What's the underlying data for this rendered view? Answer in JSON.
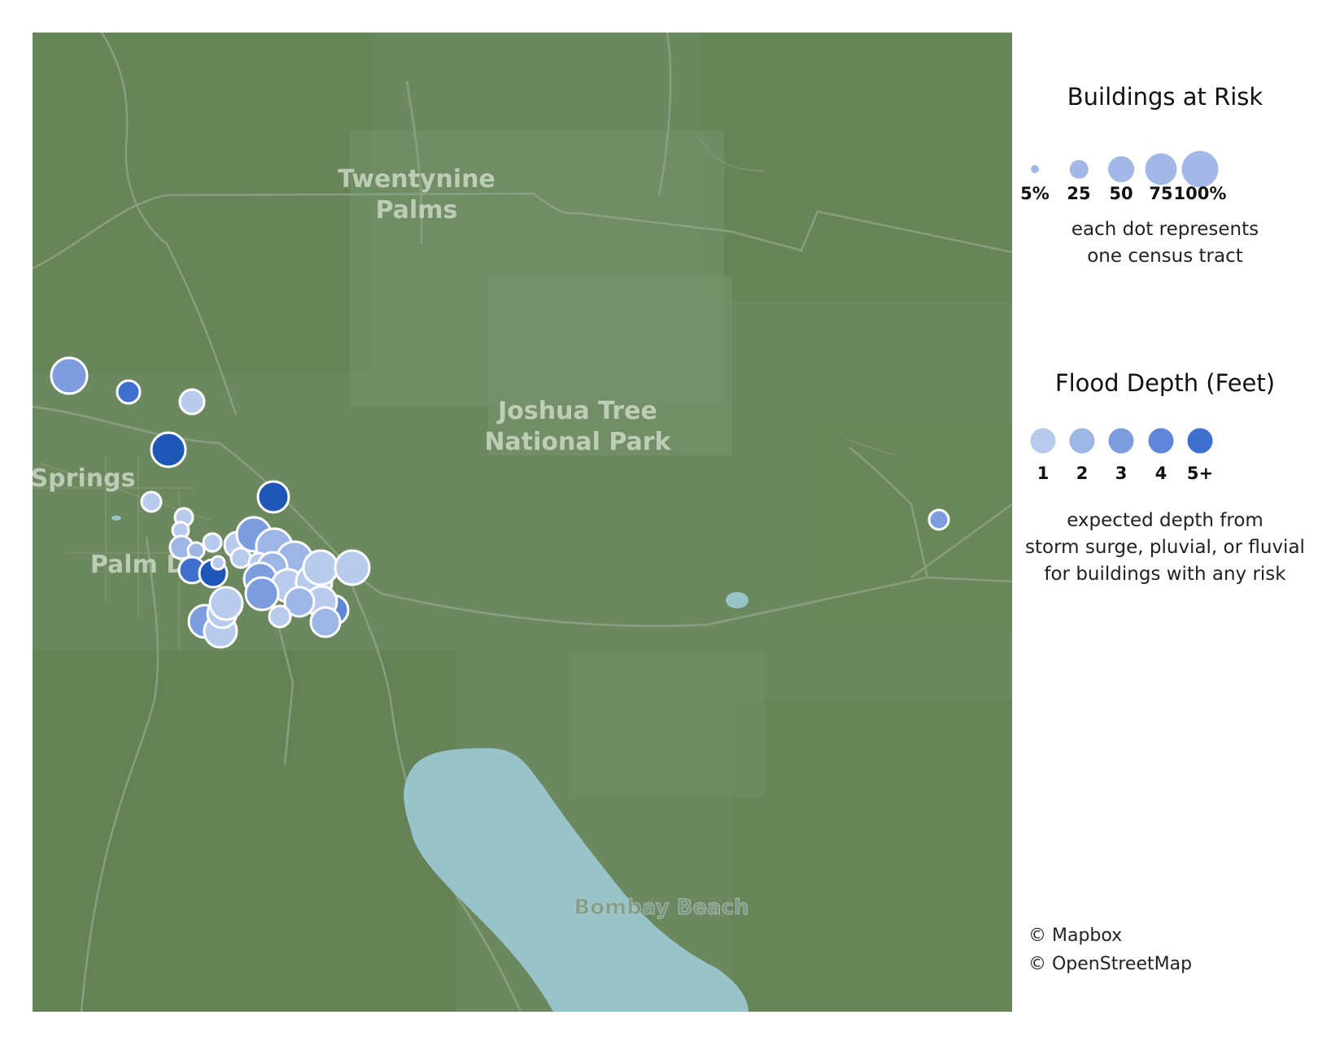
{
  "map": {
    "places": [
      {
        "id": "twentynine-palms",
        "lines": [
          "Twentynine",
          "Palms"
        ]
      },
      {
        "id": "joshua-tree",
        "lines": [
          "Joshua Tree",
          "National Park"
        ]
      },
      {
        "id": "springs",
        "lines": [
          "Springs"
        ]
      },
      {
        "id": "palm-d",
        "lines": [
          "Palm D"
        ]
      },
      {
        "id": "bombay-beach",
        "lines": [
          "Bombay Beach"
        ]
      }
    ],
    "colors": {
      "land": "#6c885f",
      "land_dark": "#668258",
      "land_light": "#738f68",
      "road": "#8ba283",
      "water": "#97c3c9",
      "dot_stroke": "#ffffff"
    }
  },
  "legend": {
    "size": {
      "title": "Buildings at Risk",
      "items": [
        {
          "label": "5%",
          "value": 5
        },
        {
          "label": "25",
          "value": 25
        },
        {
          "label": "50",
          "value": 50
        },
        {
          "label": "75",
          "value": 75
        },
        {
          "label": "100%",
          "value": 100
        }
      ],
      "note_lines": [
        "each dot represents",
        "one census tract"
      ],
      "color": "#a3b8e6"
    },
    "depth": {
      "title": "Flood Depth (Feet)",
      "items": [
        {
          "label": "1",
          "color": "#b9cbec"
        },
        {
          "label": "2",
          "color": "#9eb6e6"
        },
        {
          "label": "3",
          "color": "#7e9ddf"
        },
        {
          "label": "4",
          "color": "#5f86d8"
        },
        {
          "label": "5+",
          "color": "#3f6fcf"
        }
      ],
      "note_lines": [
        "expected depth from",
        "storm surge, pluvial, or fluvial",
        "for buildings with any risk"
      ]
    },
    "credits": [
      "© Mapbox",
      "© OpenStreetMap"
    ]
  }
}
